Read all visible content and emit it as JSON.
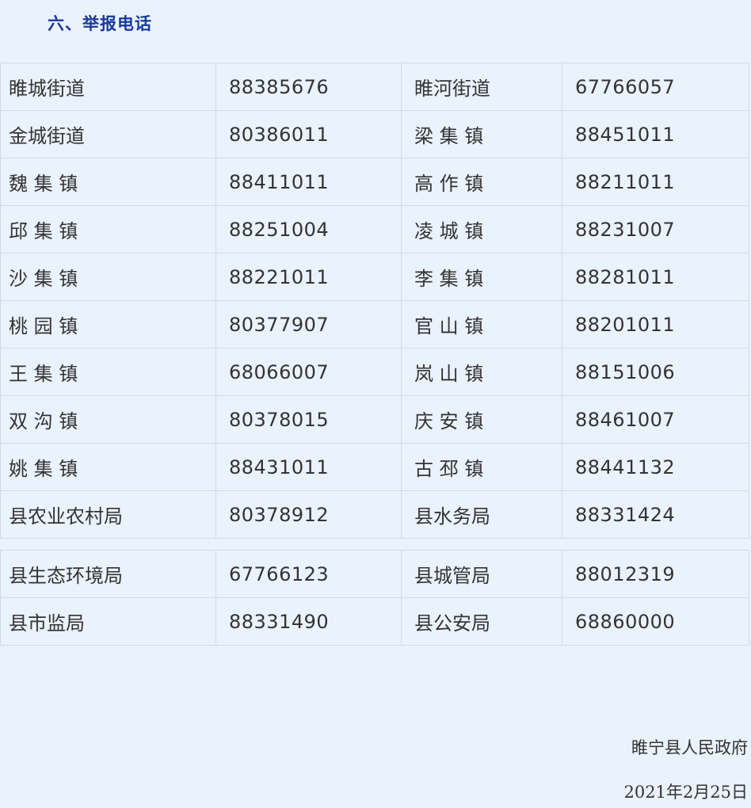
{
  "section": {
    "title": "六、举报电话"
  },
  "table_a": {
    "rows": [
      {
        "name1": "睢城街道",
        "phone1": "88385676",
        "name2": "睢河街道",
        "phone2": "67766057"
      },
      {
        "name1": "金城街道",
        "phone1": "80386011",
        "name2": "梁 集 镇",
        "phone2": "88451011"
      },
      {
        "name1": "魏 集 镇",
        "phone1": "88411011",
        "name2": "高 作 镇",
        "phone2": "88211011"
      },
      {
        "name1": "邱 集 镇",
        "phone1": "88251004",
        "name2": "凌 城 镇",
        "phone2": "88231007"
      },
      {
        "name1": "沙 集 镇",
        "phone1": "88221011",
        "name2": "李 集 镇",
        "phone2": "88281011"
      },
      {
        "name1": "桃 园 镇",
        "phone1": "80377907",
        "name2": "官 山 镇",
        "phone2": "88201011"
      },
      {
        "name1": "王 集 镇",
        "phone1": "68066007",
        "name2": "岚 山 镇",
        "phone2": "88151006"
      },
      {
        "name1": "双 沟 镇",
        "phone1": "80378015",
        "name2": "庆 安 镇",
        "phone2": "88461007"
      },
      {
        "name1": "姚 集 镇",
        "phone1": "88431011",
        "name2": "古 邳 镇",
        "phone2": "88441132"
      },
      {
        "name1": "县农业农村局",
        "phone1": "80378912",
        "name2": "县水务局",
        "phone2": "88331424"
      }
    ]
  },
  "table_b": {
    "rows": [
      {
        "name1": "县生态环境局",
        "phone1": "67766123",
        "name2": "县城管局",
        "phone2": "88012319"
      },
      {
        "name1": "县市监局",
        "phone1": "88331490",
        "name2": "县公安局",
        "phone2": "68860000"
      }
    ]
  },
  "signature": {
    "organization": "睢宁县人民政府",
    "date": "2021年2月25日"
  },
  "colors": {
    "background": "#eaf2fd",
    "heading": "#1a3a9a",
    "text": "#333333",
    "border": "#d3dae4"
  }
}
